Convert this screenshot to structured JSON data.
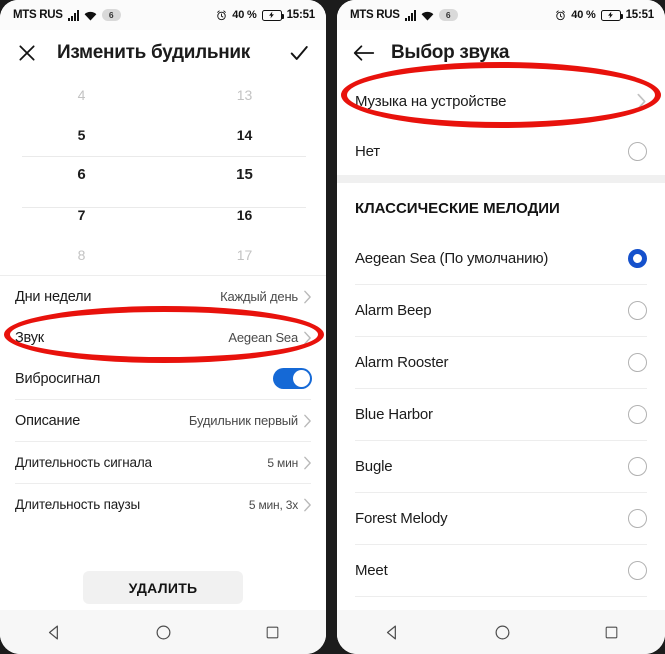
{
  "status_bar": {
    "carrier": "MTS RUS",
    "sim_badge": "6",
    "battery_percent": "40 %",
    "time": "15:51",
    "signal_icon": "signal-bars-icon",
    "wifi_icon": "wifi-icon",
    "alarm_icon": "alarm-clock-icon",
    "battery_icon": "battery-charging-icon"
  },
  "left_screen": {
    "appbar": {
      "close_icon": "close-icon",
      "title": "Изменить будильник",
      "confirm_icon": "check-icon"
    },
    "time_picker": {
      "hours": [
        "4",
        "5",
        "6",
        "7",
        "8"
      ],
      "minutes": [
        "13",
        "14",
        "15",
        "16",
        "17"
      ],
      "selected_hour": "6",
      "selected_minute": "15"
    },
    "settings": [
      {
        "label": "Дни недели",
        "value": "Каждый день",
        "chevron": "chevron-right-icon"
      },
      {
        "label": "Звук",
        "value": "Aegean Sea",
        "chevron": "chevron-right-icon"
      },
      {
        "label": "Вибросигнал",
        "toggle": "on"
      },
      {
        "label": "Описание",
        "value": "Будильник первый",
        "chevron": "chevron-right-icon"
      },
      {
        "label": "Длительность сигнала",
        "value": "5 мин",
        "chevron": "chevron-right-icon"
      },
      {
        "label": "Длительность паузы",
        "value": "5 мин, 3х",
        "chevron": "chevron-right-icon"
      }
    ],
    "delete_button": "УДАЛИТЬ"
  },
  "right_screen": {
    "appbar": {
      "back_icon": "arrow-back-icon",
      "title": "Выбор звука"
    },
    "device_music": {
      "label": "Музыка на устройстве",
      "chevron": "chevron-right-icon"
    },
    "none_option": {
      "label": "Нет",
      "selected": false
    },
    "section_header": "КЛАССИЧЕСКИЕ МЕЛОДИИ",
    "melodies": [
      {
        "label": "Aegean Sea (По умолчанию)",
        "selected": true
      },
      {
        "label": "Alarm Beep",
        "selected": false
      },
      {
        "label": "Alarm Rooster",
        "selected": false
      },
      {
        "label": "Blue Harbor",
        "selected": false
      },
      {
        "label": "Bugle",
        "selected": false
      },
      {
        "label": "Forest Melody",
        "selected": false
      },
      {
        "label": "Meet",
        "selected": false
      }
    ]
  },
  "nav_bar": {
    "back_icon": "nav-back-triangle-icon",
    "home_icon": "nav-home-circle-icon",
    "recents_icon": "nav-recents-square-icon"
  },
  "annotations": {
    "highlight_color": "#e8120c",
    "left_highlight_target": "Звук",
    "right_highlight_target": "Музыка на устройстве"
  },
  "colors": {
    "accent_blue": "#1551cc",
    "toggle_blue": "#1569d6",
    "red": "#e8120c"
  }
}
